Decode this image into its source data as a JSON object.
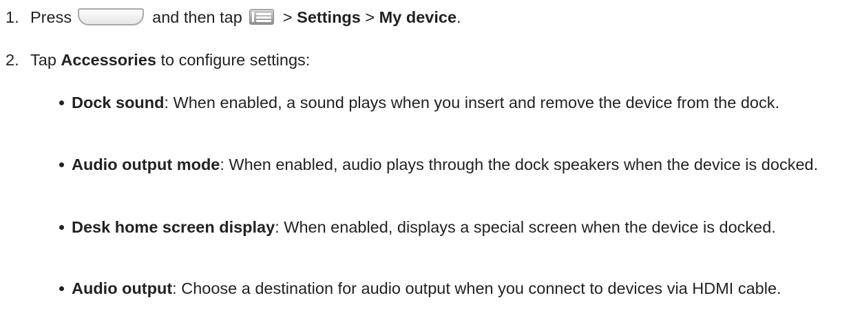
{
  "steps": [
    {
      "number": "1.",
      "text_press": "Press",
      "home_key_icon": "home-key-icon",
      "text_then_tap": "and then tap",
      "menu_key_icon": "menu-key-icon",
      "sep1": ">",
      "settings": "Settings",
      "sep2": ">",
      "my_device": "My device",
      "end": "."
    },
    {
      "number": "2.",
      "text_tap": "Tap",
      "accessories": "Accessories",
      "rest": "to configure settings:"
    }
  ],
  "bullets": [
    {
      "term": "Dock sound",
      "desc": ": When enabled, a sound plays when you insert and remove the device from the dock."
    },
    {
      "term": "Audio output mode",
      "desc": ": When enabled, audio plays through the dock speakers when the device is docked."
    },
    {
      "term": "Desk home screen display",
      "desc": ": When enabled, displays a special screen when the device is docked."
    },
    {
      "term": "Audio output",
      "desc": ": Choose a destination for audio output when you connect to devices via HDMI cable."
    }
  ]
}
